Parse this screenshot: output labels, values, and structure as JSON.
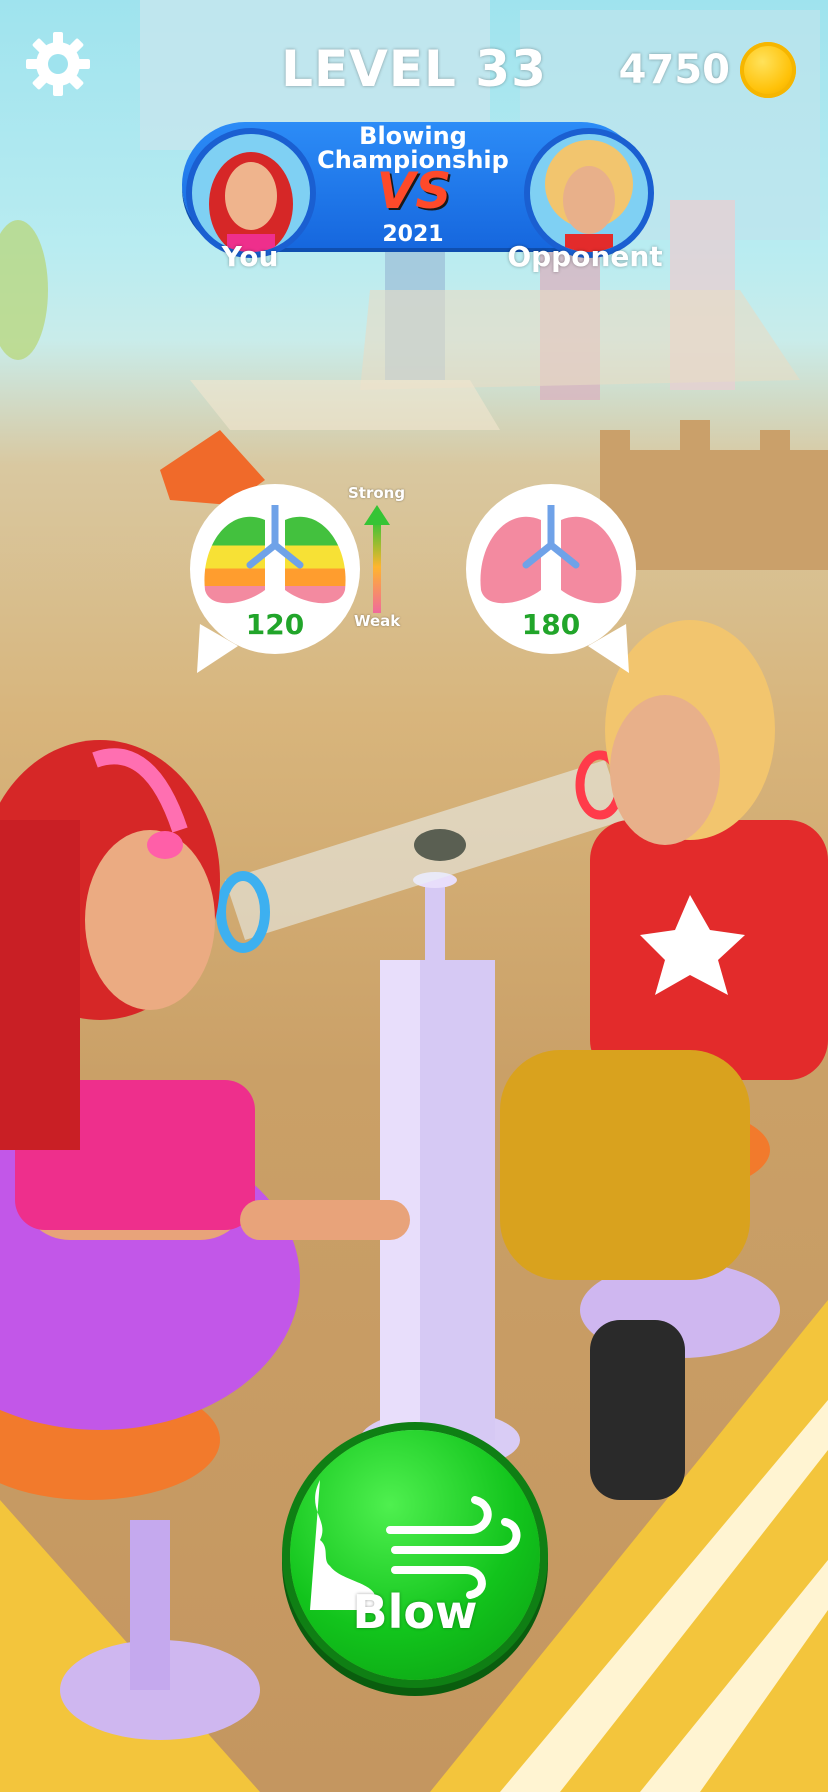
{
  "hud": {
    "level_label": "LEVEL 33",
    "coins": "4750"
  },
  "banner": {
    "title_line1": "Blowing",
    "title_line2": "Championship",
    "vs": "VS",
    "year": "2021",
    "player_label": "You",
    "opponent_label": "Opponent"
  },
  "lungs": {
    "player_value": "120",
    "opponent_value": "180",
    "meter_strong": "Strong",
    "meter_weak": "Weak"
  },
  "action": {
    "blow_label": "Blow"
  },
  "colors": {
    "accent_blue": "#1667de",
    "blow_green": "#12c41c",
    "coin_gold": "#ffc107",
    "value_green": "#21a52a"
  },
  "icons": {
    "settings": "gear-icon",
    "coin": "coin-icon",
    "blow": "blowing-face-icon"
  }
}
